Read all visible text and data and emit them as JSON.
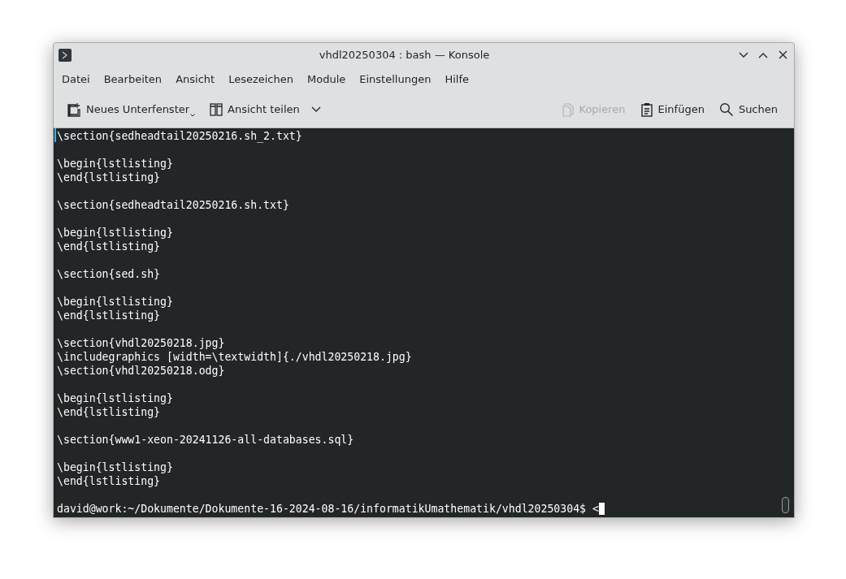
{
  "window": {
    "title": "vhdl20250304 : bash — Konsole"
  },
  "menu": [
    "Datei",
    "Bearbeiten",
    "Ansicht",
    "Lesezeichen",
    "Module",
    "Einstellungen",
    "Hilfe"
  ],
  "toolbar": [
    {
      "label": "Neues Unterfenster",
      "disabled": false
    },
    {
      "label": "Ansicht teilen",
      "disabled": false
    },
    {
      "label": "Kopieren",
      "disabled": true
    },
    {
      "label": "Einfügen",
      "disabled": false
    },
    {
      "label": "Suchen",
      "disabled": false
    }
  ],
  "terminal": {
    "lines": [
      {
        "kind": "text",
        "text": "\\section{sedheadtail20250216.sh_2.txt}"
      },
      {
        "kind": "blank"
      },
      {
        "kind": "text",
        "text": "\\begin{lstlisting}"
      },
      {
        "kind": "text",
        "text": "\\end{lstlisting}"
      },
      {
        "kind": "blank"
      },
      {
        "kind": "text",
        "text": "\\section{sedheadtail20250216.sh.txt}"
      },
      {
        "kind": "blank"
      },
      {
        "kind": "text",
        "text": "\\begin{lstlisting}"
      },
      {
        "kind": "text",
        "text": "\\end{lstlisting}"
      },
      {
        "kind": "blank"
      },
      {
        "kind": "text",
        "text": "\\section{sed.sh}"
      },
      {
        "kind": "blank"
      },
      {
        "kind": "text",
        "text": "\\begin{lstlisting}"
      },
      {
        "kind": "text",
        "text": "\\end{lstlisting}"
      },
      {
        "kind": "blank"
      },
      {
        "kind": "text",
        "text": "\\section{vhdl20250218.jpg}"
      },
      {
        "kind": "text",
        "text": "\\includegraphics [width=\\textwidth]{./vhdl20250218.jpg}"
      },
      {
        "kind": "text",
        "text": "\\section{vhdl20250218.odg}"
      },
      {
        "kind": "blank"
      },
      {
        "kind": "text",
        "text": "\\begin{lstlisting}"
      },
      {
        "kind": "text",
        "text": "\\end{lstlisting}"
      },
      {
        "kind": "blank"
      },
      {
        "kind": "text",
        "text": "\\section{www1-xeon-20241126-all-databases.sql}"
      },
      {
        "kind": "blank"
      },
      {
        "kind": "text",
        "text": "\\begin{lstlisting}"
      },
      {
        "kind": "text",
        "text": "\\end{lstlisting}"
      },
      {
        "kind": "blank"
      }
    ],
    "prompt": "david@work:~/Dokumente/Dokumente-16-2024-08-16/informatikUmathematik/vhdl20250304$ <"
  }
}
